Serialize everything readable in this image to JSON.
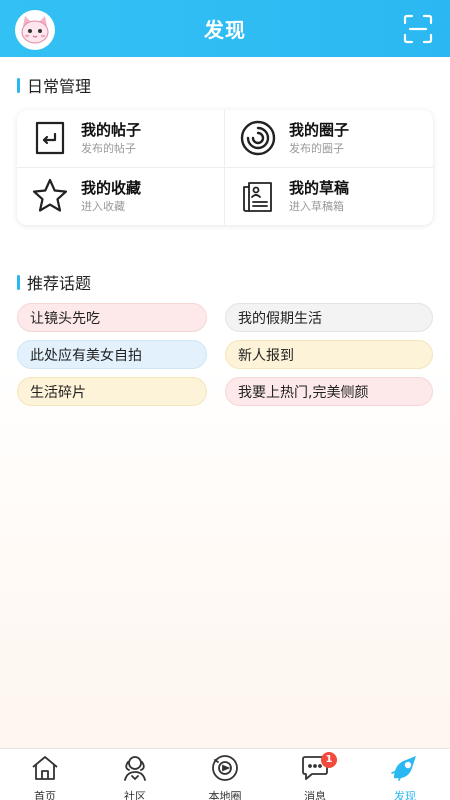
{
  "header": {
    "title": "发现",
    "avatar_icon": "cat-avatar-icon",
    "scan_icon": "scan-icon",
    "color": "#2bb8f2"
  },
  "daily": {
    "title": "日常管理",
    "items": [
      {
        "title": "我的帖子",
        "sub": "发布的帖子",
        "icon": "post-icon"
      },
      {
        "title": "我的圈子",
        "sub": "发布的圈子",
        "icon": "circle-icon"
      },
      {
        "title": "我的收藏",
        "sub": "进入收藏",
        "icon": "star-icon"
      },
      {
        "title": "我的草稿",
        "sub": "进入草稿箱",
        "icon": "draft-icon"
      }
    ]
  },
  "topics": {
    "title": "推荐话题",
    "items": [
      {
        "label": "让镜头先吃",
        "color": "#fde9ea"
      },
      {
        "label": "我的假期生活",
        "color": "#f3f3f3"
      },
      {
        "label": "此处应有美女自拍",
        "color": "#e2f1fb"
      },
      {
        "label": "新人报到",
        "color": "#fdf3d8"
      },
      {
        "label": "生活碎片",
        "color": "#fdf3d8"
      },
      {
        "label": "我要上热门,完美侧颜",
        "color": "#fde9ea"
      }
    ]
  },
  "tabbar": {
    "items": [
      {
        "label": "首页",
        "icon": "home-icon"
      },
      {
        "label": "社区",
        "icon": "community-icon"
      },
      {
        "label": "本地圈",
        "icon": "local-circle-icon"
      },
      {
        "label": "消息",
        "icon": "message-icon",
        "badge": "1"
      },
      {
        "label": "发现",
        "icon": "discover-icon",
        "active": true
      }
    ],
    "active_color": "#2bb8f2"
  }
}
